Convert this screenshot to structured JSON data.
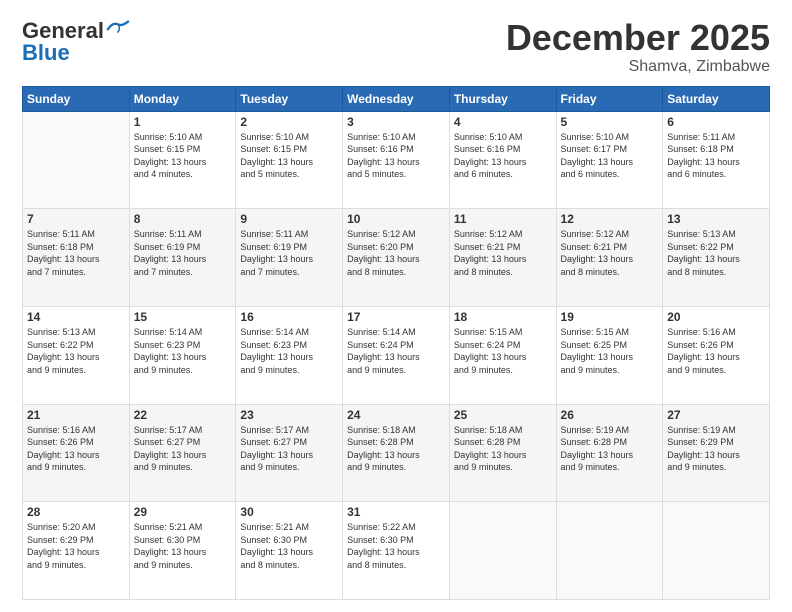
{
  "header": {
    "logo_general": "General",
    "logo_blue": "Blue",
    "month": "December 2025",
    "location": "Shamva, Zimbabwe"
  },
  "weekdays": [
    "Sunday",
    "Monday",
    "Tuesday",
    "Wednesday",
    "Thursday",
    "Friday",
    "Saturday"
  ],
  "rows": [
    [
      {
        "day": "",
        "text": ""
      },
      {
        "day": "1",
        "text": "Sunrise: 5:10 AM\nSunset: 6:15 PM\nDaylight: 13 hours\nand 4 minutes."
      },
      {
        "day": "2",
        "text": "Sunrise: 5:10 AM\nSunset: 6:15 PM\nDaylight: 13 hours\nand 5 minutes."
      },
      {
        "day": "3",
        "text": "Sunrise: 5:10 AM\nSunset: 6:16 PM\nDaylight: 13 hours\nand 5 minutes."
      },
      {
        "day": "4",
        "text": "Sunrise: 5:10 AM\nSunset: 6:16 PM\nDaylight: 13 hours\nand 6 minutes."
      },
      {
        "day": "5",
        "text": "Sunrise: 5:10 AM\nSunset: 6:17 PM\nDaylight: 13 hours\nand 6 minutes."
      },
      {
        "day": "6",
        "text": "Sunrise: 5:11 AM\nSunset: 6:18 PM\nDaylight: 13 hours\nand 6 minutes."
      }
    ],
    [
      {
        "day": "7",
        "text": "Sunrise: 5:11 AM\nSunset: 6:18 PM\nDaylight: 13 hours\nand 7 minutes."
      },
      {
        "day": "8",
        "text": "Sunrise: 5:11 AM\nSunset: 6:19 PM\nDaylight: 13 hours\nand 7 minutes."
      },
      {
        "day": "9",
        "text": "Sunrise: 5:11 AM\nSunset: 6:19 PM\nDaylight: 13 hours\nand 7 minutes."
      },
      {
        "day": "10",
        "text": "Sunrise: 5:12 AM\nSunset: 6:20 PM\nDaylight: 13 hours\nand 8 minutes."
      },
      {
        "day": "11",
        "text": "Sunrise: 5:12 AM\nSunset: 6:21 PM\nDaylight: 13 hours\nand 8 minutes."
      },
      {
        "day": "12",
        "text": "Sunrise: 5:12 AM\nSunset: 6:21 PM\nDaylight: 13 hours\nand 8 minutes."
      },
      {
        "day": "13",
        "text": "Sunrise: 5:13 AM\nSunset: 6:22 PM\nDaylight: 13 hours\nand 8 minutes."
      }
    ],
    [
      {
        "day": "14",
        "text": "Sunrise: 5:13 AM\nSunset: 6:22 PM\nDaylight: 13 hours\nand 9 minutes."
      },
      {
        "day": "15",
        "text": "Sunrise: 5:14 AM\nSunset: 6:23 PM\nDaylight: 13 hours\nand 9 minutes."
      },
      {
        "day": "16",
        "text": "Sunrise: 5:14 AM\nSunset: 6:23 PM\nDaylight: 13 hours\nand 9 minutes."
      },
      {
        "day": "17",
        "text": "Sunrise: 5:14 AM\nSunset: 6:24 PM\nDaylight: 13 hours\nand 9 minutes."
      },
      {
        "day": "18",
        "text": "Sunrise: 5:15 AM\nSunset: 6:24 PM\nDaylight: 13 hours\nand 9 minutes."
      },
      {
        "day": "19",
        "text": "Sunrise: 5:15 AM\nSunset: 6:25 PM\nDaylight: 13 hours\nand 9 minutes."
      },
      {
        "day": "20",
        "text": "Sunrise: 5:16 AM\nSunset: 6:26 PM\nDaylight: 13 hours\nand 9 minutes."
      }
    ],
    [
      {
        "day": "21",
        "text": "Sunrise: 5:16 AM\nSunset: 6:26 PM\nDaylight: 13 hours\nand 9 minutes."
      },
      {
        "day": "22",
        "text": "Sunrise: 5:17 AM\nSunset: 6:27 PM\nDaylight: 13 hours\nand 9 minutes."
      },
      {
        "day": "23",
        "text": "Sunrise: 5:17 AM\nSunset: 6:27 PM\nDaylight: 13 hours\nand 9 minutes."
      },
      {
        "day": "24",
        "text": "Sunrise: 5:18 AM\nSunset: 6:28 PM\nDaylight: 13 hours\nand 9 minutes."
      },
      {
        "day": "25",
        "text": "Sunrise: 5:18 AM\nSunset: 6:28 PM\nDaylight: 13 hours\nand 9 minutes."
      },
      {
        "day": "26",
        "text": "Sunrise: 5:19 AM\nSunset: 6:28 PM\nDaylight: 13 hours\nand 9 minutes."
      },
      {
        "day": "27",
        "text": "Sunrise: 5:19 AM\nSunset: 6:29 PM\nDaylight: 13 hours\nand 9 minutes."
      }
    ],
    [
      {
        "day": "28",
        "text": "Sunrise: 5:20 AM\nSunset: 6:29 PM\nDaylight: 13 hours\nand 9 minutes."
      },
      {
        "day": "29",
        "text": "Sunrise: 5:21 AM\nSunset: 6:30 PM\nDaylight: 13 hours\nand 9 minutes."
      },
      {
        "day": "30",
        "text": "Sunrise: 5:21 AM\nSunset: 6:30 PM\nDaylight: 13 hours\nand 8 minutes."
      },
      {
        "day": "31",
        "text": "Sunrise: 5:22 AM\nSunset: 6:30 PM\nDaylight: 13 hours\nand 8 minutes."
      },
      {
        "day": "",
        "text": ""
      },
      {
        "day": "",
        "text": ""
      },
      {
        "day": "",
        "text": ""
      }
    ]
  ]
}
